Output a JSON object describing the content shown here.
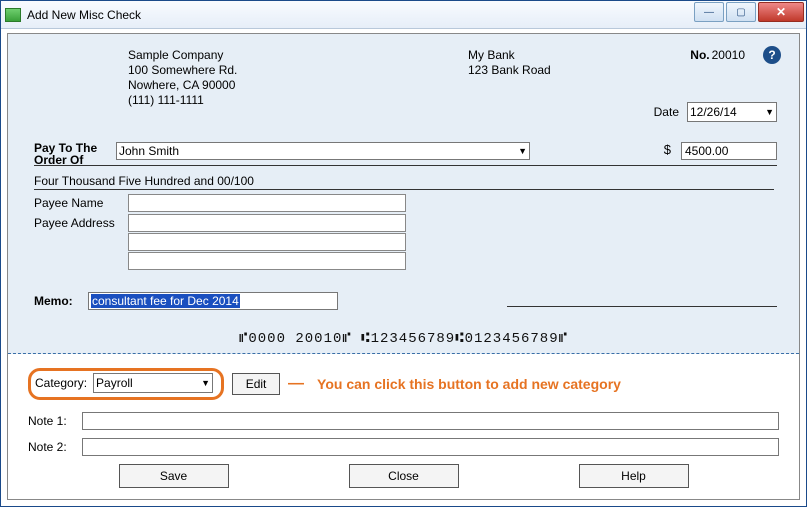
{
  "window": {
    "title": "Add New Misc Check"
  },
  "company": {
    "name": "Sample Company",
    "street": "100 Somewhere Rd.",
    "citystate": "Nowhere, CA 90000",
    "phone": "(111) 111-1111"
  },
  "bank": {
    "name": "My Bank",
    "street": "123 Bank Road"
  },
  "check": {
    "no_label": "No.",
    "no_value": "20010",
    "date_label": "Date",
    "date_value": "12/26/14",
    "payto_label_line1": "Pay To The",
    "payto_label_line2": "Order Of",
    "payee_selected": "John Smith",
    "currency_symbol": "$",
    "amount": "4500.00",
    "amount_words": "Four Thousand Five Hundred  and 00/100",
    "payee_name_label": "Payee Name",
    "payee_address_label": "Payee Address",
    "payee_name_value": "",
    "payee_addr1": "",
    "payee_addr2": "",
    "payee_addr3": "",
    "memo_label": "Memo:",
    "memo_value": "consultant fee for Dec 2014",
    "micr": "⑈0000 20010⑈ ⑆123456789⑆0123456789⑈"
  },
  "lower": {
    "category_label": "Category:",
    "category_value": "Payroll",
    "edit_label": "Edit",
    "annotation": "You can click this button to add new category",
    "note1_label": "Note 1:",
    "note1_value": "",
    "note2_label": "Note 2:",
    "note2_value": ""
  },
  "buttons": {
    "save": "Save",
    "close": "Close",
    "help": "Help"
  }
}
